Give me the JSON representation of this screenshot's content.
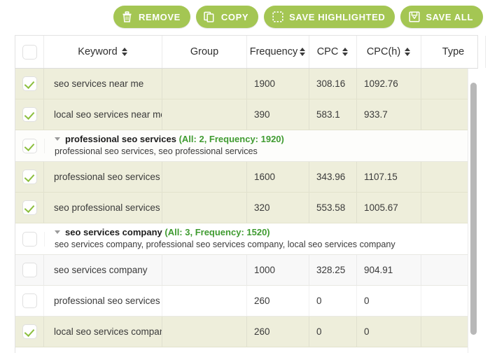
{
  "toolbar": {
    "buttons": [
      {
        "label": "REMOVE",
        "icon": "trash-icon"
      },
      {
        "label": "COPY",
        "icon": "copy-icon"
      },
      {
        "label": "SAVE HIGHLIGHTED",
        "icon": "dashed-square-icon"
      },
      {
        "label": "SAVE ALL",
        "icon": "save-disk-icon"
      }
    ],
    "accent_color": "#a4c653"
  },
  "table": {
    "columns": [
      {
        "key": "select",
        "label": "",
        "sortable": false
      },
      {
        "key": "keyword",
        "label": "Keyword",
        "sortable": true
      },
      {
        "key": "group",
        "label": "Group",
        "sortable": false
      },
      {
        "key": "frequency",
        "label": "Frequency",
        "sortable": true
      },
      {
        "key": "cpc",
        "label": "CPC",
        "sortable": true
      },
      {
        "key": "cpch",
        "label": "CPC(h)",
        "sortable": true
      },
      {
        "key": "type",
        "label": "Type",
        "sortable": false
      }
    ],
    "header_checkbox_checked": false,
    "rows": [
      {
        "kind": "keyword",
        "checked": true,
        "keyword": "seo services near me",
        "frequency": "1900",
        "cpc": "308.16",
        "cpch": "1092.76",
        "type": ""
      },
      {
        "kind": "keyword",
        "checked": true,
        "keyword": "local seo services near me",
        "frequency": "390",
        "cpc": "583.1",
        "cpch": "933.7",
        "type": ""
      },
      {
        "kind": "group",
        "checked": true,
        "title": "professional seo services",
        "meta": "(All: 2, Frequency: 1920)",
        "members": "professional seo services, seo professional services"
      },
      {
        "kind": "keyword",
        "checked": true,
        "keyword": "professional seo services",
        "frequency": "1600",
        "cpc": "343.96",
        "cpch": "1107.15",
        "type": ""
      },
      {
        "kind": "keyword",
        "checked": true,
        "keyword": "seo professional services",
        "frequency": "320",
        "cpc": "553.58",
        "cpch": "1005.67",
        "type": ""
      },
      {
        "kind": "group",
        "checked": false,
        "title": "seo services company",
        "meta": "(All: 3, Frequency: 1520)",
        "members": "seo services company, professional seo services company, local seo services company"
      },
      {
        "kind": "keyword",
        "checked": false,
        "keyword": "seo services company",
        "frequency": "1000",
        "cpc": "328.25",
        "cpch": "904.91",
        "type": ""
      },
      {
        "kind": "keyword",
        "checked": false,
        "keyword": "professional seo services company",
        "frequency": "260",
        "cpc": "0",
        "cpch": "0",
        "type": ""
      },
      {
        "kind": "keyword",
        "checked": true,
        "keyword": "local seo services company",
        "frequency": "260",
        "cpc": "0",
        "cpch": "0",
        "type": ""
      }
    ]
  }
}
